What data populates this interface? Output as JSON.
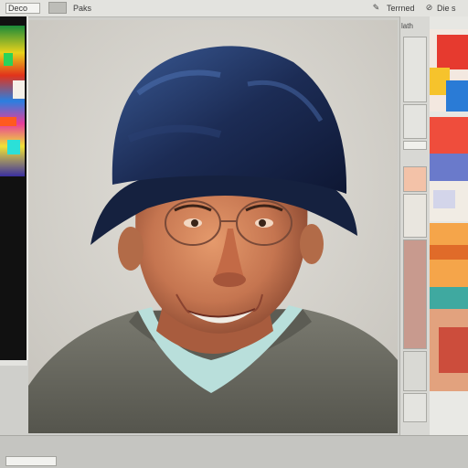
{
  "topbar": {
    "field_text": "Deco",
    "menu_text": "Paks",
    "right_text_1": "Terrned",
    "right_text_2": "Die s",
    "icons": [
      "brush-icon",
      "eyedropper-icon",
      "fill-icon"
    ]
  },
  "tool_column": {
    "label": "lath"
  },
  "colors": {
    "hat": "#1c2c55",
    "hat_highlight": "#3a5a95",
    "skin": "#c97a55",
    "sweater": "#6f6f66",
    "collar": "#b9dfdb",
    "canvas_bg": "#d6d3cd"
  }
}
